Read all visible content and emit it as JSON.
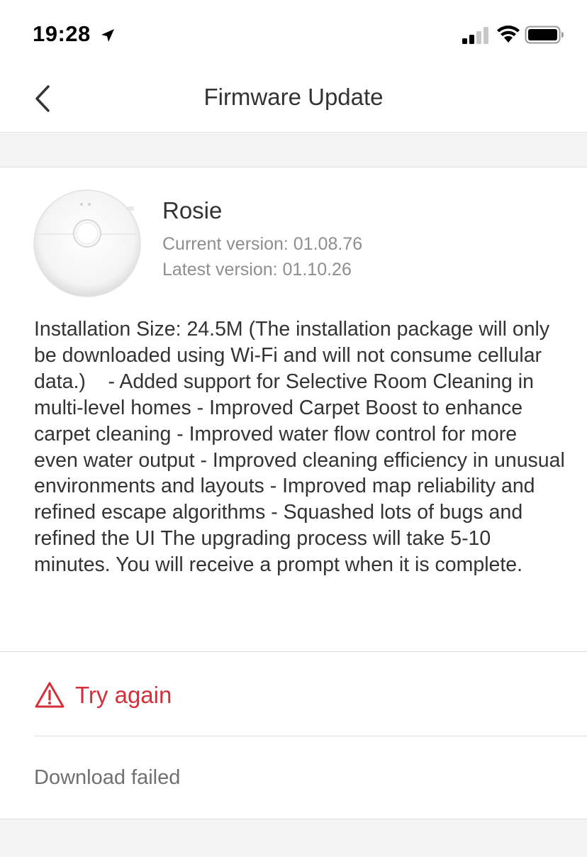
{
  "status_bar": {
    "time": "19:28",
    "icons": [
      "location-arrow-icon",
      "cellular-signal-icon",
      "wifi-icon",
      "battery-icon"
    ]
  },
  "nav": {
    "title": "Firmware Update",
    "back_icon": "chevron-left-icon"
  },
  "device": {
    "name": "Rosie",
    "image": "robot-vacuum-image",
    "current_version": "Current version: 01.08.76",
    "latest_version": "Latest version: 01.10.26"
  },
  "release_notes": "Installation Size: 24.5M (The installation package will only be downloaded using Wi-Fi and will not consume cellular data.)    - Added support for Selective Room Cleaning in multi-level homes - Improved Carpet Boost to enhance carpet cleaning - Improved water flow control for more even water output - Improved cleaning efficiency in unusual environments and layouts - Improved map reliability and refined escape algorithms - Squashed lots of bugs and refined the UI The upgrading process will take 5-10 minutes. You will receive a prompt when it is complete.",
  "action": {
    "label": "Try again",
    "icon": "warning-triangle-icon",
    "color": "#d62f3a"
  },
  "status": {
    "text": "Download failed"
  }
}
